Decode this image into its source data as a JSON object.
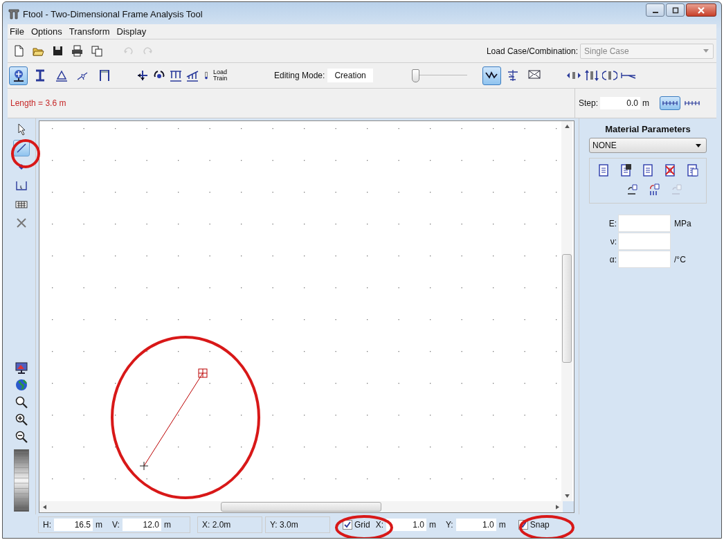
{
  "window": {
    "title": "Ftool - Two-Dimensional Frame Analysis Tool"
  },
  "menu": [
    "File",
    "Options",
    "Transform",
    "Display"
  ],
  "file_toolbar": [
    {
      "disabled": false
    },
    {
      "disabled": false
    },
    {
      "disabled": false
    },
    {
      "disabled": false
    },
    {
      "disabled": false
    },
    {
      "disabled": true
    },
    {
      "disabled": true
    }
  ],
  "load_case": {
    "label": "Load Case/Combination:",
    "value": "Single Case",
    "disabled": true
  },
  "model_toolbar": [
    {
      "selected": true
    },
    {
      "selected": false
    },
    {
      "selected": false
    },
    {
      "selected": false
    },
    {
      "selected": false
    }
  ],
  "load_train": "Load Train",
  "editing_mode": {
    "label": "Editing Mode:",
    "value": "Creation"
  },
  "zoom_slider": {
    "level": 0
  },
  "view_toolbar": [
    {
      "selected": true
    },
    {
      "selected": false
    },
    {
      "selected": false
    }
  ],
  "status_message": "Length = 3.6 m",
  "step": {
    "label": "Step:",
    "value": "0.0",
    "unit": "m",
    "rulers": [
      {
        "selected": true
      },
      {
        "selected": false
      }
    ]
  },
  "tools": [
    {
      "selected": false
    },
    {
      "selected": true
    },
    {
      "selected": false
    },
    {
      "selected": false
    },
    {
      "selected": false
    },
    {
      "selected": false
    }
  ],
  "material": {
    "title": "Material Parameters",
    "selection": "NONE",
    "actions": [
      {
        "disabled": false
      },
      {
        "disabled": false
      },
      {
        "disabled": false
      },
      {
        "disabled": false
      },
      {
        "disabled": false
      },
      {
        "disabled": false
      },
      {
        "disabled": false
      },
      {
        "disabled": true
      }
    ],
    "fields": [
      {
        "label": "E:",
        "unit": "MPa"
      },
      {
        "label": "ν:"
      },
      {
        "label": "α:",
        "unit": "/°C"
      }
    ]
  },
  "status_bar": {
    "h": {
      "label": "H:",
      "value": "16.5",
      "unit": "m"
    },
    "v": {
      "label": "V:",
      "value": "12.0",
      "unit": "m"
    },
    "x_coord": "X: 2.0m",
    "y_coord": "Y: 3.0m",
    "grid": {
      "label": "Grid",
      "checked": true
    },
    "grid_x": {
      "label": "X:",
      "value": "1.0",
      "unit": "m"
    },
    "grid_y": {
      "label": "Y:",
      "value": "1.0",
      "unit": "m"
    },
    "snap": {
      "label": "Snap",
      "checked": true
    }
  }
}
